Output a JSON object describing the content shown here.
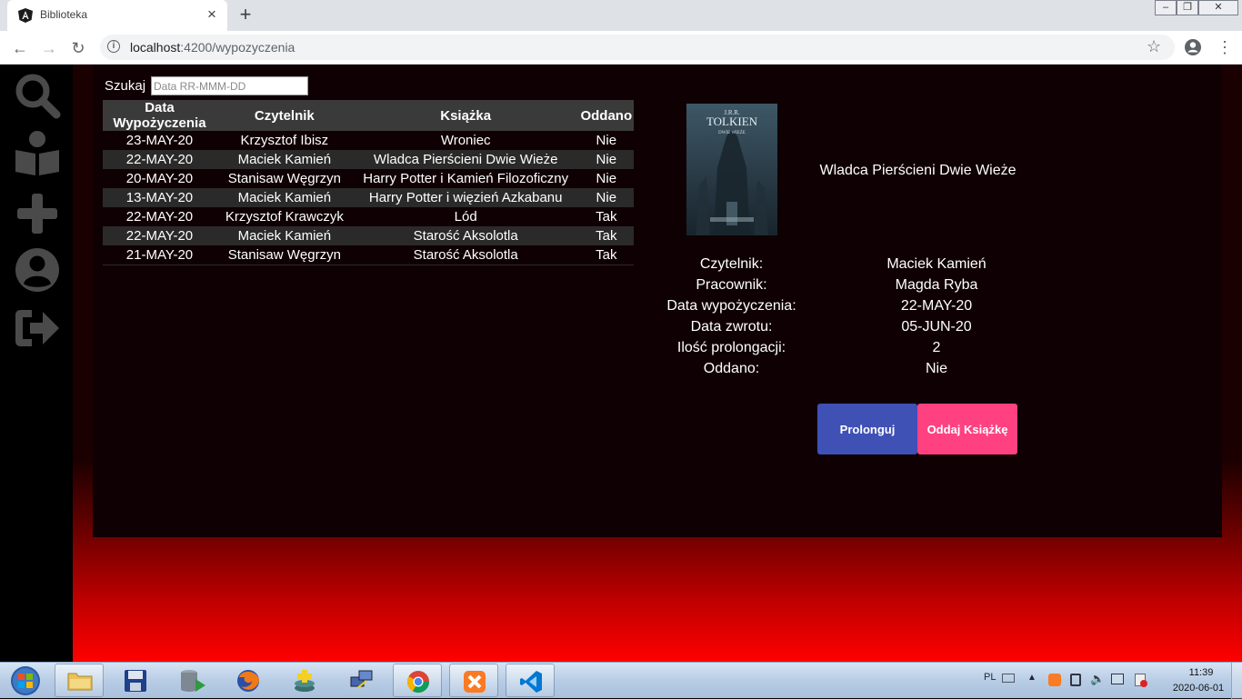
{
  "browser": {
    "tab_title": "Biblioteka",
    "url_host": "localhost",
    "url_rest": ":4200/wypozyczenia"
  },
  "sidebar": {
    "icons": [
      "search-icon",
      "book-reader-icon",
      "plus-icon",
      "user-circle-icon",
      "logout-icon"
    ]
  },
  "search": {
    "label": "Szukaj",
    "placeholder": "Data RR-MMM-DD"
  },
  "table": {
    "headers": [
      "Data Wypożyczenia",
      "Czytelnik",
      "Książka",
      "Oddano"
    ],
    "rows": [
      [
        "23-MAY-20",
        "Krzysztof Ibisz",
        "Wroniec",
        "Nie"
      ],
      [
        "22-MAY-20",
        "Maciek Kamień",
        "Wladca Pierścieni Dwie Wieże",
        "Nie"
      ],
      [
        "20-MAY-20",
        "Stanisaw Węgrzyn",
        "Harry Potter i Kamień Filozoficzny",
        "Nie"
      ],
      [
        "13-MAY-20",
        "Maciek Kamień",
        "Harry Potter i więzień Azkabanu",
        "Nie"
      ],
      [
        "22-MAY-20",
        "Krzysztof Krawczyk",
        "Lód",
        "Tak"
      ],
      [
        "22-MAY-20",
        "Maciek Kamień",
        "Starość Aksolotla",
        "Tak"
      ],
      [
        "21-MAY-20",
        "Stanisaw Węgrzyn",
        "Starość Aksolotla",
        "Tak"
      ]
    ]
  },
  "details": {
    "cover": {
      "author": "J.R.R. TOLKIEN",
      "subtitle": "DWIE WIEŻE"
    },
    "title": "Wladca Pierścieni Dwie Wieże",
    "fields": [
      {
        "label": "Czytelnik:",
        "value": "Maciek Kamień"
      },
      {
        "label": "Pracownik:",
        "value": "Magda Ryba"
      },
      {
        "label": "Data wypożyczenia:",
        "value": "22-MAY-20"
      },
      {
        "label": "Data zwrotu:",
        "value": "05-JUN-20"
      },
      {
        "label": "Ilość prolongacji:",
        "value": "2"
      },
      {
        "label": "Oddano:",
        "value": "Nie"
      }
    ],
    "prolong_label": "Prolonguj",
    "return_label": "Oddaj Książkę"
  },
  "colors": {
    "prolong_button": "#3f51b5",
    "return_button": "#ff4081"
  },
  "taskbar": {
    "language": "PL",
    "time": "11:39",
    "date": "2020-06-01"
  }
}
